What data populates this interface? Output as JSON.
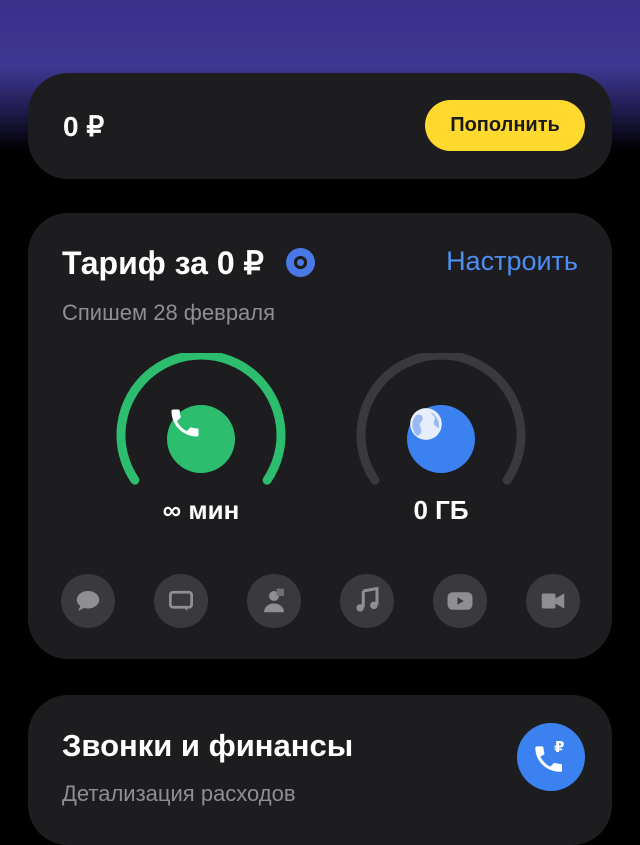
{
  "balance": {
    "value": "0 ₽",
    "topup_label": "Пополнить"
  },
  "tariff": {
    "title": "Тариф за 0 ₽",
    "configure_label": "Настроить",
    "debit_date": "Спишем 28 февраля",
    "minutes": {
      "label": "∞ мин",
      "remaining_fraction": 1.0,
      "color": "#2dbd6e"
    },
    "internet": {
      "label": "0 ГБ",
      "remaining_fraction": 0.0,
      "color": "#3b82f0"
    },
    "services": [
      "chat-bubble-icon",
      "message-icon",
      "social-network-icon",
      "music-icon",
      "youtube-icon",
      "video-camera-icon"
    ]
  },
  "calls_finance": {
    "title": "Звонки и финансы",
    "subtitle": "Детализация расходов"
  },
  "colors": {
    "accent_yellow": "#ffd92e",
    "link_blue": "#4d8ef0",
    "card_bg": "#1d1d1f",
    "top_gradient": "#3f3792"
  }
}
